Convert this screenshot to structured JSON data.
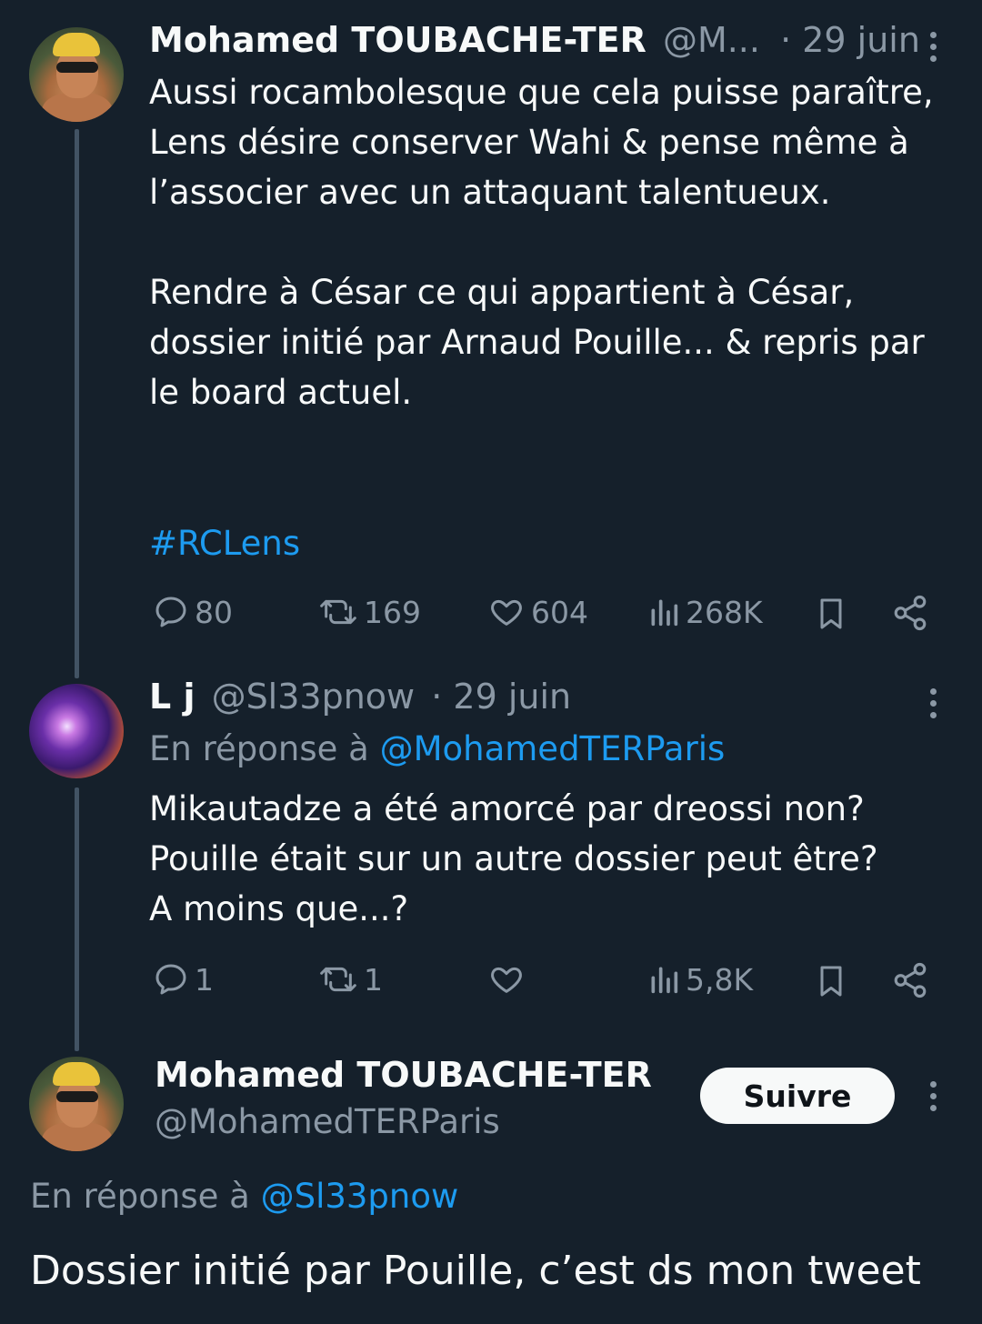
{
  "tweet1": {
    "author_name": "Mohamed TOUBACHE-TER",
    "handle_truncated": "@M...",
    "date": "· 29 juin",
    "body": "Aussi rocambolesque que cela puisse paraître, Lens désire conserver Wahi & pense même à l’associer avec un attaquant talentueux.\n\nRendre à César ce qui appartient à César, dossier initié par Arnaud Pouille... & repris par le board actuel.",
    "hashtag": "#RCLens",
    "stats": {
      "replies": "80",
      "reposts": "169",
      "likes": "604",
      "views": "268K"
    }
  },
  "tweet2": {
    "author_name": "L j",
    "handle": "@Sl33pnow",
    "date": "· 29 juin",
    "reply_prefix": "En réponse à",
    "reply_to": "@MohamedTERParis",
    "body": "Mikautadze a été amorcé par dreossi non?\nPouille était sur un autre dossier peut être?\nA moins que...?",
    "stats": {
      "replies": "1",
      "reposts": "1",
      "likes": "",
      "views": "5,8K"
    }
  },
  "tweet3": {
    "author_name": "Mohamed TOUBACHE-TER",
    "handle": "@MohamedTERParis",
    "follow_label": "Suivre",
    "reply_prefix": "En réponse à",
    "reply_to": "@Sl33pnow",
    "body": "Dossier initié par Pouille, c’est ds mon tweet"
  },
  "colors": {
    "background": "#15202b",
    "text": "#f7f9f9",
    "muted": "#8b98a5",
    "link": "#1d9bf0",
    "thread_line": "#425364"
  },
  "icons": [
    "reply-icon",
    "repost-icon",
    "like-icon",
    "views-icon",
    "bookmark-icon",
    "share-icon",
    "more-icon"
  ]
}
